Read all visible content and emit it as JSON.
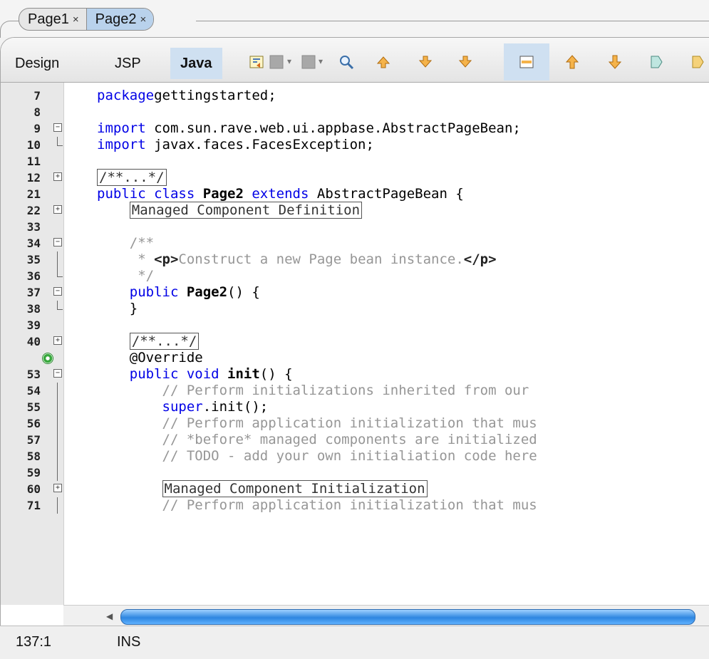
{
  "tabs": [
    {
      "label": "Page1",
      "close": "×",
      "active": false
    },
    {
      "label": "Page2",
      "close": "×",
      "active": true
    }
  ],
  "toolbar": {
    "views": [
      "Design",
      "JSP",
      "Java"
    ],
    "active_view": "Java",
    "icons": [
      "toggle-bookmark-icon",
      "back-icon",
      "forward-icon",
      "find-icon",
      "previous-occurrence-icon",
      "next-occurrence-icon",
      "toggle-highlight-icon",
      "shift-left-icon",
      "shift-right-icon",
      "start-macro-icon",
      "stop-macro-icon"
    ]
  },
  "editor": {
    "lines": [
      {
        "n": "7",
        "tokens": [
          [
            "kw",
            "package"
          ],
          [
            "",
            "gettingstarted;"
          ]
        ]
      },
      {
        "n": "8",
        "tokens": []
      },
      {
        "n": "9",
        "fold": "minus",
        "tokens": [
          [
            "kw",
            "import"
          ],
          [
            "",
            " com.sun.rave.web.ui.appbase.AbstractPageBean;"
          ]
        ]
      },
      {
        "n": "10",
        "foldend": true,
        "tokens": [
          [
            "kw",
            "import"
          ],
          [
            "",
            " javax.faces.FacesException;"
          ]
        ]
      },
      {
        "n": "11",
        "tokens": []
      },
      {
        "n": "12",
        "fold": "plus",
        "tokens": [
          [
            "box cm",
            "/**...*/"
          ]
        ]
      },
      {
        "n": "21",
        "tokens": [
          [
            "kw",
            "public class "
          ],
          [
            "b",
            "Page2"
          ],
          [
            "kw",
            " extends"
          ],
          [
            "",
            " AbstractPageBean {"
          ]
        ]
      },
      {
        "n": "22",
        "fold": "plus",
        "tokens": [
          [
            "",
            "    "
          ],
          [
            "box",
            "Managed Component Definition"
          ]
        ]
      },
      {
        "n": "33",
        "tokens": []
      },
      {
        "n": "34",
        "fold": "minus",
        "tokens": [
          [
            "cm",
            "    /**"
          ]
        ]
      },
      {
        "n": "35",
        "line": true,
        "tokens": [
          [
            "cm",
            "     * "
          ],
          [
            "tag",
            "<p>"
          ],
          [
            "cm",
            "Construct a new Page bean instance."
          ],
          [
            "tag",
            "</p>"
          ]
        ]
      },
      {
        "n": "36",
        "foldend": true,
        "tokens": [
          [
            "cm",
            "     */"
          ]
        ]
      },
      {
        "n": "37",
        "fold": "minus",
        "tokens": [
          [
            "kw",
            "    public "
          ],
          [
            "b",
            "Page2"
          ],
          [
            "",
            "() {"
          ]
        ]
      },
      {
        "n": "38",
        "foldend": true,
        "tokens": [
          [
            "",
            "    }"
          ]
        ]
      },
      {
        "n": "39",
        "tokens": []
      },
      {
        "n": "40",
        "fold": "plus",
        "tokens": [
          [
            "",
            "    "
          ],
          [
            "box cm",
            "/**...*/"
          ]
        ]
      },
      {
        "n": "",
        "override": true,
        "tokens": [
          [
            "ann",
            "    @Override"
          ]
        ]
      },
      {
        "n": "53",
        "fold": "minus",
        "tokens": [
          [
            "kw",
            "    public void "
          ],
          [
            "b",
            "init"
          ],
          [
            "",
            "() {"
          ]
        ]
      },
      {
        "n": "54",
        "line": true,
        "tokens": [
          [
            "cm",
            "        // Perform initializations inherited from our"
          ]
        ]
      },
      {
        "n": "55",
        "line": true,
        "tokens": [
          [
            "kw",
            "        super"
          ],
          [
            "",
            ".init();"
          ]
        ]
      },
      {
        "n": "56",
        "line": true,
        "tokens": [
          [
            "cm",
            "        // Perform application initialization that mus"
          ]
        ]
      },
      {
        "n": "57",
        "line": true,
        "tokens": [
          [
            "cm",
            "        // *before* managed components are initialized"
          ]
        ]
      },
      {
        "n": "58",
        "line": true,
        "tokens": [
          [
            "cm",
            "        // TODO - add your own initialiation code here"
          ]
        ]
      },
      {
        "n": "59",
        "line": true,
        "tokens": []
      },
      {
        "n": "60",
        "fold": "plus",
        "tokens": [
          [
            "",
            "        "
          ],
          [
            "box",
            "Managed Component Initialization"
          ]
        ]
      },
      {
        "n": "71",
        "line": true,
        "tokens": [
          [
            "cm",
            "        // Perform application initialization that mus"
          ]
        ]
      }
    ]
  },
  "status": {
    "position": "137:1",
    "mode": "INS"
  }
}
